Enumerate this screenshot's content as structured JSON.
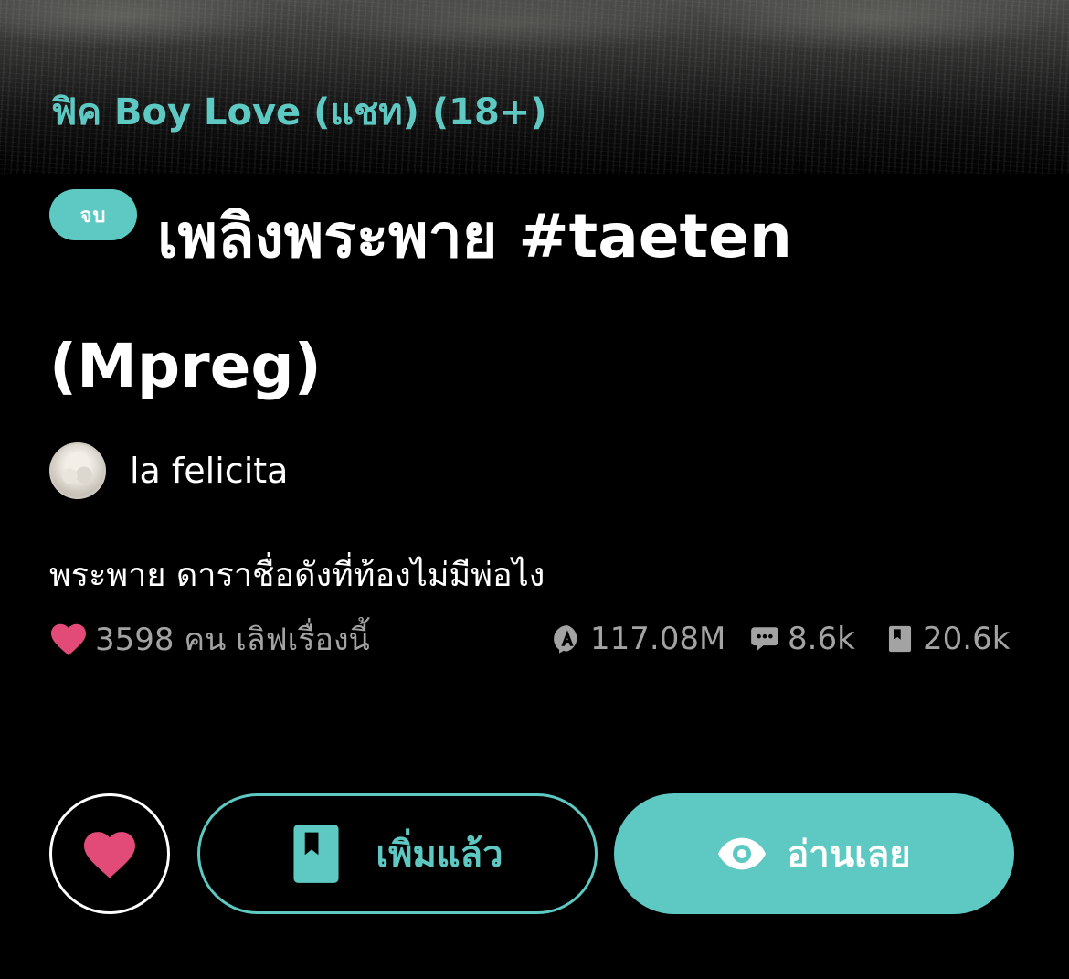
{
  "story": {
    "category": "ฟิค Boy Love (แชท) (18+)",
    "status_badge": "จบ",
    "title": "เพลิงพระพาย #taeten (Mpreg)",
    "author": "la felicita",
    "synopsis": "พระพาย ดาราชื่อดังที่ท้องไม่มีพ่อไง"
  },
  "stats": {
    "loves": "3598 คน เลิฟเรื่องนี้",
    "views": "117.08M",
    "comments": "8.6k",
    "chapters": "20.6k"
  },
  "actions": {
    "library_label": "เพิ่มแล้ว",
    "read_label": "อ่านเลย"
  },
  "icons": {
    "love": "heart-icon",
    "views": "views-icon",
    "comments": "comment-icon",
    "chapters": "book-icon",
    "library": "bookmark-book-icon",
    "read": "eye-icon"
  },
  "colors": {
    "accent": "#5ec8c2",
    "heart": "#e24a78",
    "background": "#000000",
    "muted_text": "#a3a3a3"
  }
}
